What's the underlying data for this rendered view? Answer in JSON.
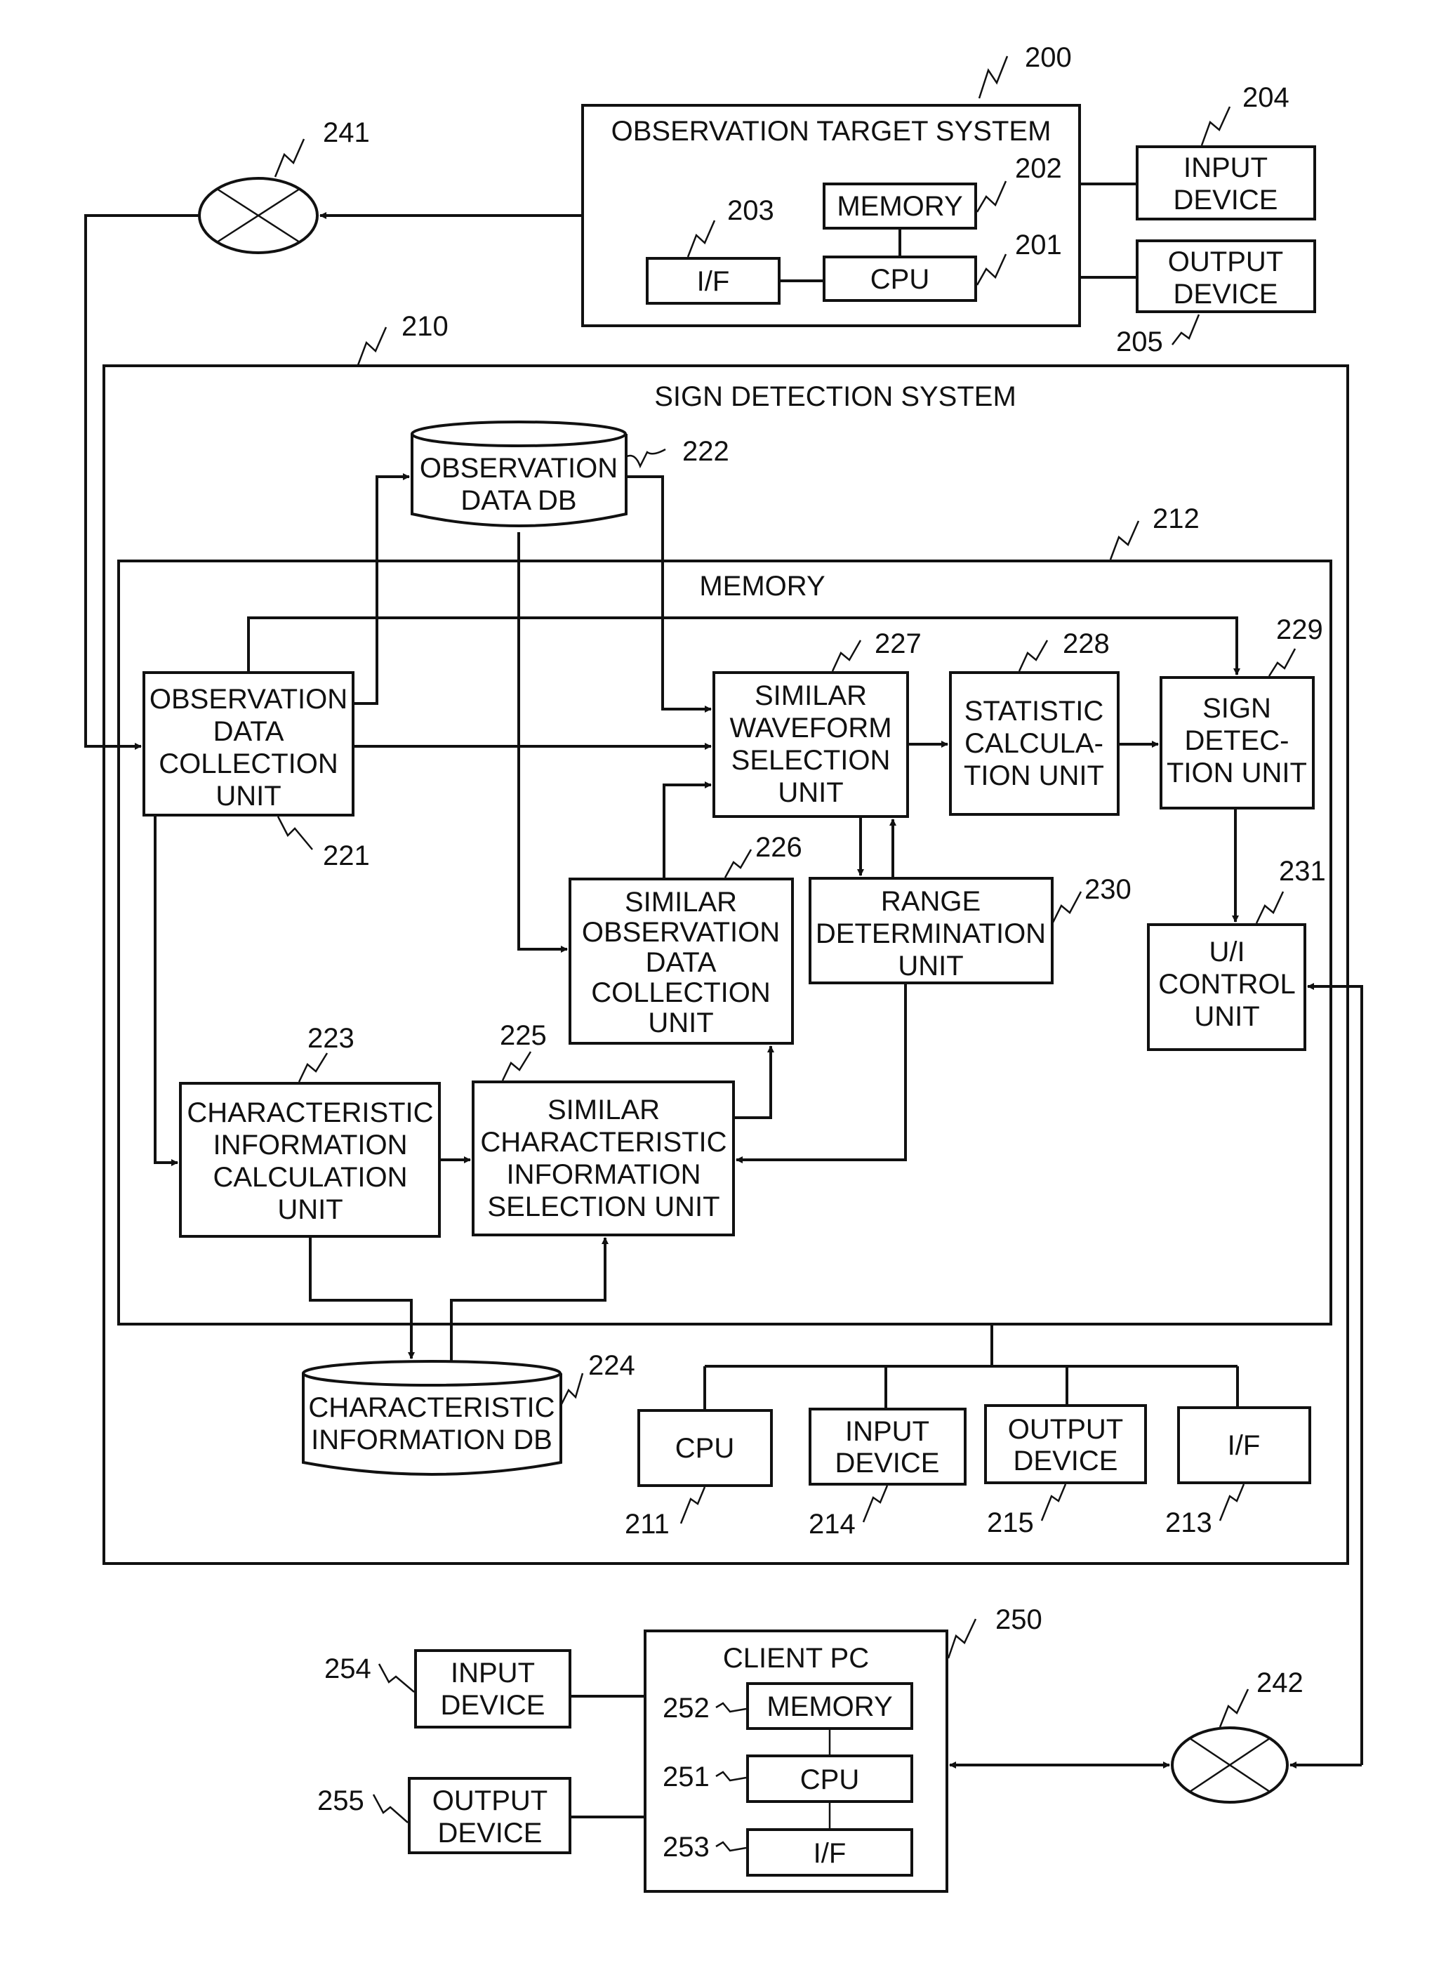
{
  "figure": {
    "observation_target_system": {
      "ref": "200",
      "title": "OBSERVATION TARGET SYSTEM",
      "memory": {
        "ref": "202",
        "label": "MEMORY"
      },
      "cpu": {
        "ref": "201",
        "label": "CPU"
      },
      "interface": {
        "ref": "203",
        "label": "I/F"
      },
      "input_device": {
        "ref": "204",
        "lines": [
          "INPUT",
          "DEVICE"
        ]
      },
      "output_device": {
        "ref": "205",
        "lines": [
          "OUTPUT",
          "DEVICE"
        ]
      }
    },
    "network_1": {
      "ref": "241"
    },
    "network_2": {
      "ref": "242"
    },
    "sign_detection_system": {
      "ref": "210",
      "title": "SIGN DETECTION SYSTEM",
      "observation_data_db": {
        "ref": "222",
        "lines": [
          "OBSERVATION",
          "DATA DB"
        ]
      },
      "memory": {
        "ref": "212",
        "title": "MEMORY",
        "observation_data_collection_unit": {
          "ref": "221",
          "lines": [
            "OBSERVATION",
            "DATA",
            "COLLECTION",
            "UNIT"
          ]
        },
        "similar_waveform_selection_unit": {
          "ref": "227",
          "lines": [
            "SIMILAR",
            "WAVEFORM",
            "SELECTION",
            "UNIT"
          ]
        },
        "statistic_calculation_unit": {
          "ref": "228",
          "lines": [
            "STATISTIC",
            "CALCULA-",
            "TION UNIT"
          ]
        },
        "sign_detection_unit": {
          "ref": "229",
          "lines": [
            "SIGN",
            "DETEC-",
            "TION UNIT"
          ]
        },
        "similar_observation_data_collection_unit": {
          "ref": "226",
          "lines": [
            "SIMILAR",
            "OBSERVATION",
            "DATA",
            "COLLECTION",
            "UNIT"
          ]
        },
        "range_determination_unit": {
          "ref": "230",
          "lines": [
            "RANGE",
            "DETERMINATION",
            "UNIT"
          ]
        },
        "ui_control_unit": {
          "ref": "231",
          "lines": [
            "U/I",
            "CONTROL",
            "UNIT"
          ]
        },
        "characteristic_information_calculation_unit": {
          "ref": "223",
          "lines": [
            "CHARACTERISTIC",
            "INFORMATION",
            "CALCULATION",
            "UNIT"
          ]
        },
        "similar_characteristic_information_selection_unit": {
          "ref": "225",
          "lines": [
            "SIMILAR",
            "CHARACTERISTIC",
            "INFORMATION",
            "SELECTION UNIT"
          ]
        }
      },
      "characteristic_information_db": {
        "ref": "224",
        "lines": [
          "CHARACTERISTIC",
          "INFORMATION DB"
        ]
      },
      "cpu": {
        "ref": "211",
        "label": "CPU"
      },
      "input_device": {
        "ref": "214",
        "lines": [
          "INPUT",
          "DEVICE"
        ]
      },
      "output_device": {
        "ref": "215",
        "lines": [
          "OUTPUT",
          "DEVICE"
        ]
      },
      "interface": {
        "ref": "213",
        "label": "I/F"
      }
    },
    "client_pc": {
      "ref": "250",
      "title": "CLIENT PC",
      "memory": {
        "ref": "252",
        "label": "MEMORY"
      },
      "cpu": {
        "ref": "251",
        "label": "CPU"
      },
      "interface": {
        "ref": "253",
        "label": "I/F"
      },
      "input_device": {
        "ref": "254",
        "lines": [
          "INPUT",
          "DEVICE"
        ]
      },
      "output_device": {
        "ref": "255",
        "lines": [
          "OUTPUT",
          "DEVICE"
        ]
      }
    }
  }
}
